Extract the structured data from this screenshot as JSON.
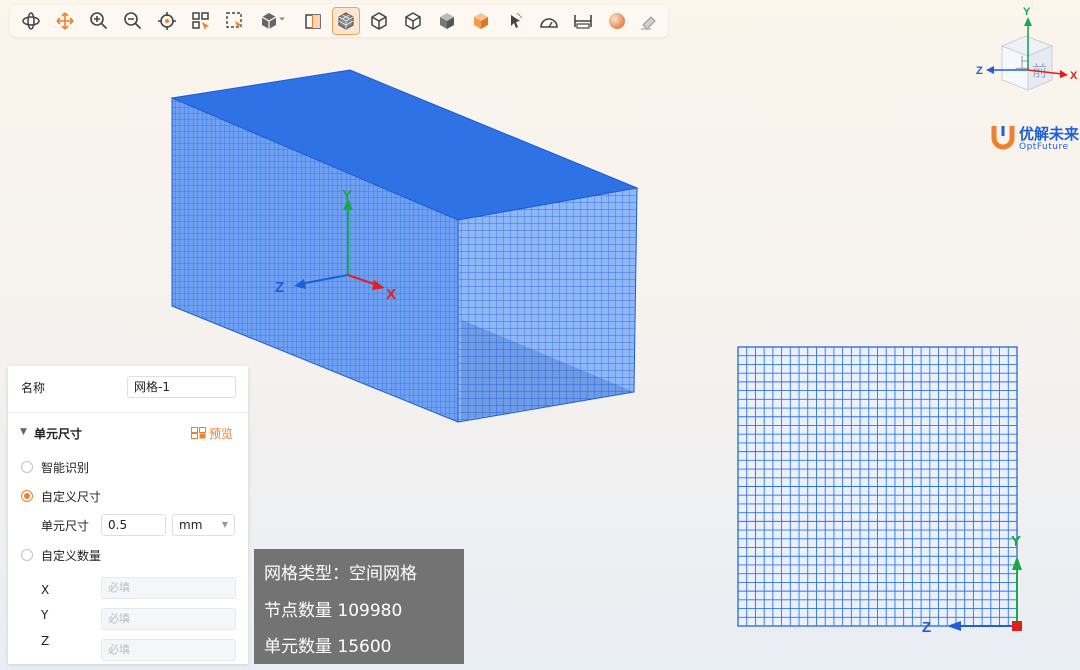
{
  "toolbar": {
    "buttons": [
      {
        "icon": "rotate-icon"
      },
      {
        "icon": "pan-icon"
      },
      {
        "icon": "zoom-in-icon"
      },
      {
        "icon": "zoom-out-icon"
      },
      {
        "icon": "target-icon"
      },
      {
        "icon": "select-box-icon"
      },
      {
        "icon": "select-window-icon"
      },
      {
        "icon": "view-cube-dropdown-icon"
      },
      {
        "icon": "section-view-icon"
      },
      {
        "icon": "mesh-display-icon",
        "active": true
      },
      {
        "icon": "wireframe-cube-icon"
      },
      {
        "icon": "shaded-edges-cube-icon"
      },
      {
        "icon": "shaded-cube-icon"
      },
      {
        "icon": "orange-cube-icon"
      },
      {
        "icon": "pointer-icon"
      },
      {
        "icon": "protractor-icon"
      },
      {
        "icon": "ruler-icon"
      },
      {
        "icon": "sphere-icon"
      },
      {
        "icon": "eraser-icon"
      }
    ]
  },
  "viewport": {
    "axis_labels": {
      "x": "X",
      "y": "Y",
      "z": "Z"
    },
    "mesh_color": "#2f72e6"
  },
  "orientation_cube": {
    "face_top": "上",
    "face_front": "前",
    "axis_x": "X",
    "axis_y": "Y",
    "axis_z": "Z"
  },
  "logo": {
    "cn": "优解未来",
    "en": "OptFuture"
  },
  "panel": {
    "name_label": "名称",
    "name_value": "网格-1",
    "section_title": "单元尺寸",
    "preview_label": "预览",
    "options": [
      {
        "label": "智能识别",
        "selected": false
      },
      {
        "label": "自定义尺寸",
        "selected": true
      },
      {
        "label": "自定义数量",
        "selected": false
      }
    ],
    "element_size_label": "单元尺寸",
    "element_size_value": "0.5",
    "unit": "mm",
    "count_fields": [
      {
        "label": "X",
        "placeholder": "必填"
      },
      {
        "label": "Y",
        "placeholder": "必填"
      },
      {
        "label": "Z",
        "placeholder": "必填"
      }
    ]
  },
  "info": {
    "mesh_type": "网格类型：空间网格",
    "node_count": "节点数量 109980",
    "element_count": "单元数量 15600"
  },
  "colors": {
    "accent": "#f07f2e",
    "mesh": "#2f72e6",
    "brand": "#1f5fd6"
  }
}
